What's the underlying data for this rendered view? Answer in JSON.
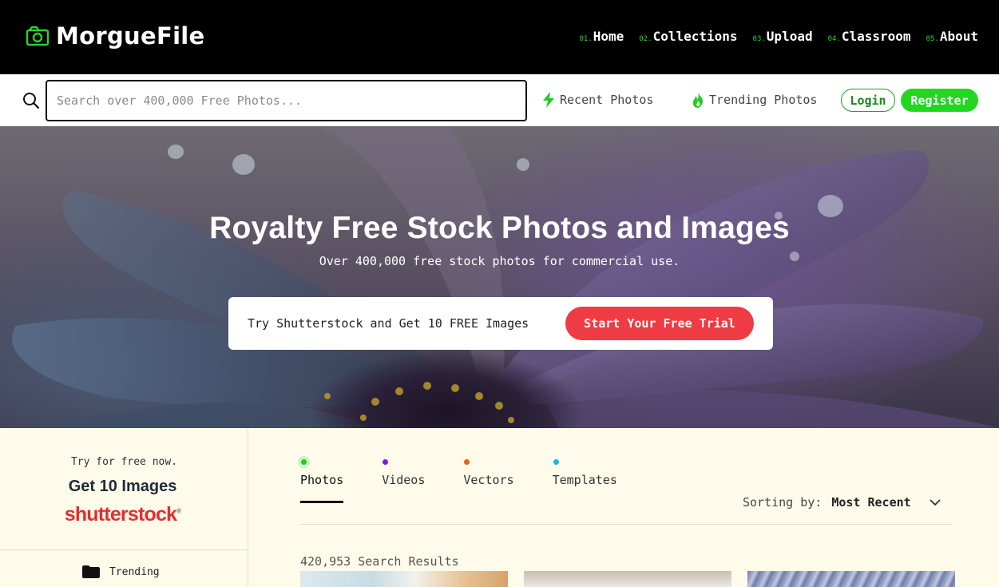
{
  "header": {
    "logo_text": "MorgueFile",
    "logo_icon": "camera-icon",
    "nav": [
      {
        "num": "01.",
        "label": "Home"
      },
      {
        "num": "02.",
        "label": "Collections"
      },
      {
        "num": "03.",
        "label": "Upload"
      },
      {
        "num": "04.",
        "label": "Classroom"
      },
      {
        "num": "05.",
        "label": "About"
      }
    ]
  },
  "search": {
    "placeholder": "Search over 400,000 Free Photos...",
    "value": "",
    "recent_label": "Recent Photos",
    "trending_label": "Trending Photos",
    "login_label": "Login",
    "register_label": "Register"
  },
  "hero": {
    "title": "Royalty Free Stock Photos and Images",
    "subtitle": "Over 400,000 free stock photos for commercial use.",
    "promo_text": "Try Shutterstock and Get 10 FREE Images",
    "promo_button": "Start Your Free Trial"
  },
  "sidebar": {
    "ad_small": "Try for free now.",
    "ad_big": "Get 10 Images",
    "ad_logo": "shutterstock",
    "links": [
      {
        "label": "Trending",
        "icon": "folder-icon"
      }
    ]
  },
  "main": {
    "tabs": [
      {
        "label": "Photos",
        "color": "#22cc22",
        "active": true
      },
      {
        "label": "Videos",
        "color": "#7a1ee6",
        "active": false
      },
      {
        "label": "Vectors",
        "color": "#e8650f",
        "active": false
      },
      {
        "label": "Templates",
        "color": "#12b8e8",
        "active": false
      }
    ],
    "sort_label": "Sorting by:",
    "sort_value": "Most Recent",
    "results_text": "420,953 Search Results"
  },
  "colors": {
    "accent": "#22d622",
    "promo_button": "#ef3b43",
    "header_bg": "#000000",
    "page_bg": "#fffbea"
  }
}
